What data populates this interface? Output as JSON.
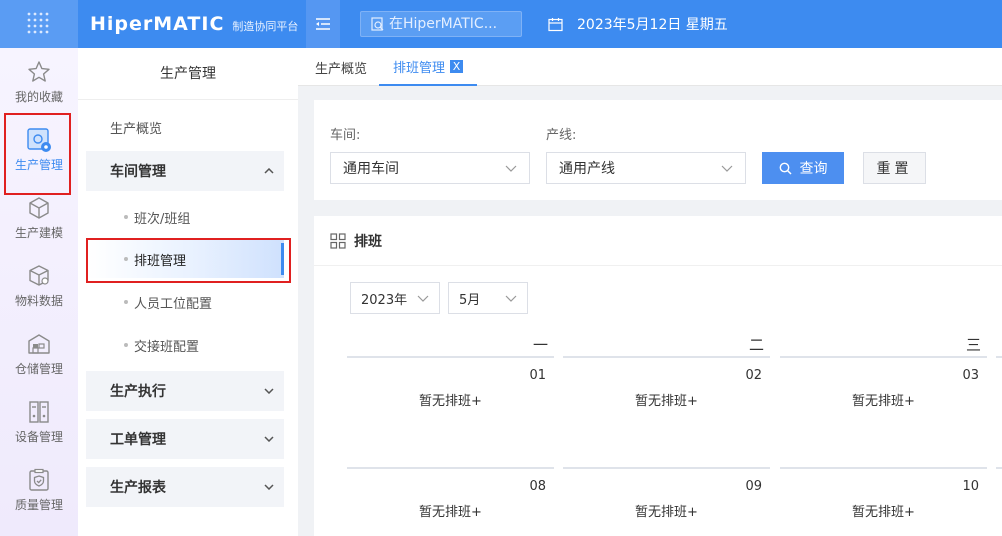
{
  "header": {
    "logo_main": "HiperMATIC",
    "logo_sub": "制造协同平台",
    "search_placeholder": "在HiperMATIC...",
    "date": "2023年5月12日 星期五",
    "brand_color": "#3d8bf0"
  },
  "rail": {
    "items": [
      {
        "label": "我的收藏",
        "icon": "star-icon"
      },
      {
        "label": "生产管理",
        "icon": "production-icon"
      },
      {
        "label": "生产建模",
        "icon": "cube-icon"
      },
      {
        "label": "物料数据",
        "icon": "box-icon"
      },
      {
        "label": "仓储管理",
        "icon": "warehouse-icon"
      },
      {
        "label": "设备管理",
        "icon": "device-icon"
      },
      {
        "label": "质量管理",
        "icon": "quality-shield-icon"
      }
    ]
  },
  "sidebar": {
    "title": "生产管理",
    "overview": "生产概览",
    "workshop_group": "车间管理",
    "workshop_items": [
      "班次/班组",
      "排班管理",
      "人员工位配置",
      "交接班配置"
    ],
    "groups": [
      "生产执行",
      "工单管理",
      "生产报表"
    ]
  },
  "tabs": [
    {
      "label": "生产概览"
    },
    {
      "label": "排班管理",
      "close": "X"
    }
  ],
  "filter": {
    "workshop_label": "车间:",
    "workshop_value": "通用车间",
    "line_label": "产线:",
    "line_value": "通用产线",
    "query_label": "查询",
    "reset_label": "重置"
  },
  "schedule": {
    "title": "排班",
    "year": "2023年",
    "month": "5月",
    "weekdays": [
      "一",
      "二",
      "三"
    ],
    "rows": [
      {
        "days": [
          "01",
          "02",
          "03"
        ],
        "text": [
          "暂无排班+",
          "暂无排班+",
          "暂无排班+"
        ]
      },
      {
        "days": [
          "08",
          "09",
          "10"
        ],
        "text": [
          "暂无排班+",
          "暂无排班+",
          "暂无排班+"
        ]
      }
    ]
  }
}
